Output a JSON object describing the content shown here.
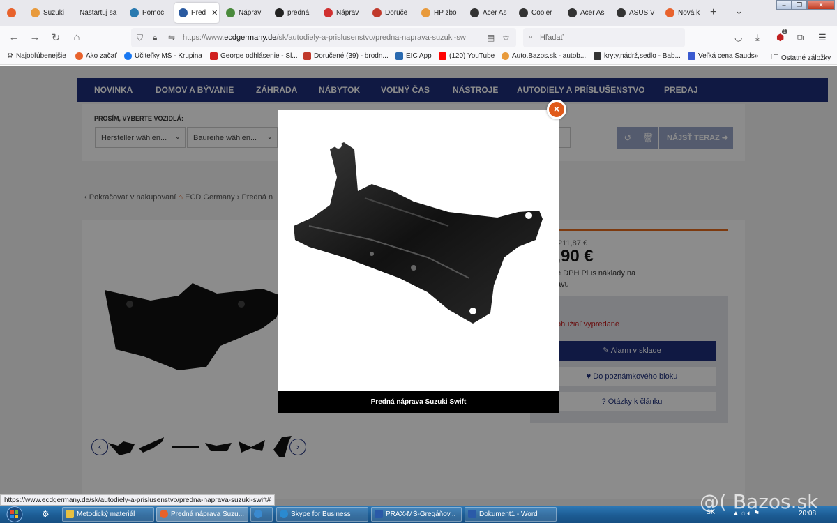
{
  "browser": {
    "tabs": [
      {
        "label": "",
        "color": "#e8622c"
      },
      {
        "label": "Suzuki",
        "color": "#e89a3c"
      },
      {
        "label": "Nastartuj sa",
        "color": "#999999"
      },
      {
        "label": "Pomoc",
        "color": "#2a7ab0"
      },
      {
        "label": "Pred",
        "color": "#2a5aa0"
      },
      {
        "label": "Náprav",
        "color": "#4a8a3c"
      },
      {
        "label": "predná",
        "color": "#222222"
      },
      {
        "label": "Náprav",
        "color": "#d03030"
      },
      {
        "label": "Doruče",
        "color": "#c0392b"
      },
      {
        "label": "HP zbo",
        "color": "#e89a3c"
      },
      {
        "label": "Acer As",
        "color": "#333333"
      },
      {
        "label": "Cooler",
        "color": "#333333"
      },
      {
        "label": "Acer As",
        "color": "#333333"
      },
      {
        "label": "ASUS V",
        "color": "#333333"
      },
      {
        "label": "Nová k",
        "color": "#e8622c"
      }
    ],
    "url_prefix": "https://www.",
    "url_domain": "ecdgermany.de",
    "url_path": "/sk/autodiely-a-prislusenstvo/predna-naprava-suzuki-sw",
    "search_placeholder": "Hľadať",
    "notification_badge": "1"
  },
  "bookmarks": [
    {
      "label": "Najobľúbenejšie",
      "color": "#555555"
    },
    {
      "label": "Ako začať",
      "color": "#e8622c"
    },
    {
      "label": "Učiteľky MŠ - Krupina",
      "color": "#1877f2"
    },
    {
      "label": "George odhlásenie - Sl...",
      "color": "#d02020"
    },
    {
      "label": "Doručené (39) - brodn...",
      "color": "#c0392b"
    },
    {
      "label": "EIC App",
      "color": "#2a6ab0"
    },
    {
      "label": "(120) YouTube",
      "color": "#ff0000"
    },
    {
      "label": "Auto.Bazos.sk - autob...",
      "color": "#e89a3c"
    },
    {
      "label": "kryty,nádrž,sedlo - Bab...",
      "color": "#333333"
    },
    {
      "label": "Veľká cena Sauds",
      "color": "#3a5ad0"
    }
  ],
  "bookmarks_other": "Ostatné záložky",
  "site": {
    "nav": [
      "NOVINKA",
      "DOMOV A BÝVANIE",
      "ZÁHRADA",
      "NÁBYTOK",
      "VOĽNÝ ČAS",
      "NÁSTROJE",
      "AUTODIELY A PRÍSLUŠENSTVO",
      "PREDAJ"
    ],
    "vehicle_label": "PROSÍM, VYBERTE VOZIDLÁ:",
    "select_manufacturer": "Hersteller wählen...",
    "select_series": "Baureihe wählen...",
    "find_button": "NÁJSŤ TERAZ",
    "breadcrumb": {
      "back": "Pokračovať v nakupovaní",
      "home": "ECD Germany",
      "current": "Predná n"
    },
    "old_price": "211,87 €",
    "new_price": "8,90 €",
    "vat_text": "e DPH Plus náklady na",
    "vat_text2": "avu",
    "stock_status": "ohužiaľ vypredané",
    "alarm_button": "Alarm v sklade",
    "notes_button": "Do poznámkového bloku",
    "questions_button": "Otázky k článku"
  },
  "lightbox": {
    "caption": "Predná náprava Suzuki Swift"
  },
  "status_url": "https://www.ecdgermany.de/sk/autodiely-a-prislusenstvo/predna-naprava-suzuki-swift#",
  "taskbar": {
    "items": [
      {
        "label": "Metodický materiál",
        "color": "#e8c040"
      },
      {
        "label": "Predná náprava Suzu...",
        "color": "#e8622c"
      },
      {
        "label": "",
        "color": "#3a8ad0"
      },
      {
        "label": "Skype for Business",
        "color": "#2a8ad0"
      },
      {
        "label": "PRAX-MŠ-Gregáňov...",
        "color": "#2a5aa8"
      },
      {
        "label": "Dokument1 - Word",
        "color": "#2a5aa8"
      }
    ],
    "lang": "SK",
    "clock": "20:08"
  },
  "watermark": "@( Bazos.sk"
}
